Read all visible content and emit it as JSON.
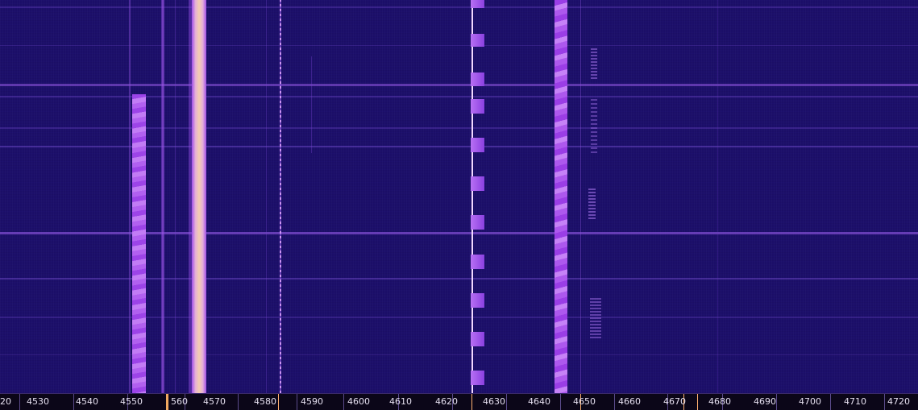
{
  "app": {
    "name": "waterfall-spectrum-display"
  },
  "colors": {
    "background": "#1c0f6b",
    "signal_strong": "#f0c0a0",
    "signal_medium": "#b060f0",
    "signal_weak": "#5a2ab0",
    "marker": "#f0a860",
    "scale_bg": "#0b0618",
    "scale_text": "#e6e0f0"
  },
  "frequency_scale": {
    "labels": [
      "20",
      "4530",
      "4540",
      "4550",
      "560",
      "4570",
      "4580",
      "4590",
      "4600",
      "4610",
      "4620",
      "4630",
      "4640",
      "4650",
      "4660",
      "4670",
      "4680",
      "4690",
      "4700",
      "4710",
      "4720"
    ]
  }
}
